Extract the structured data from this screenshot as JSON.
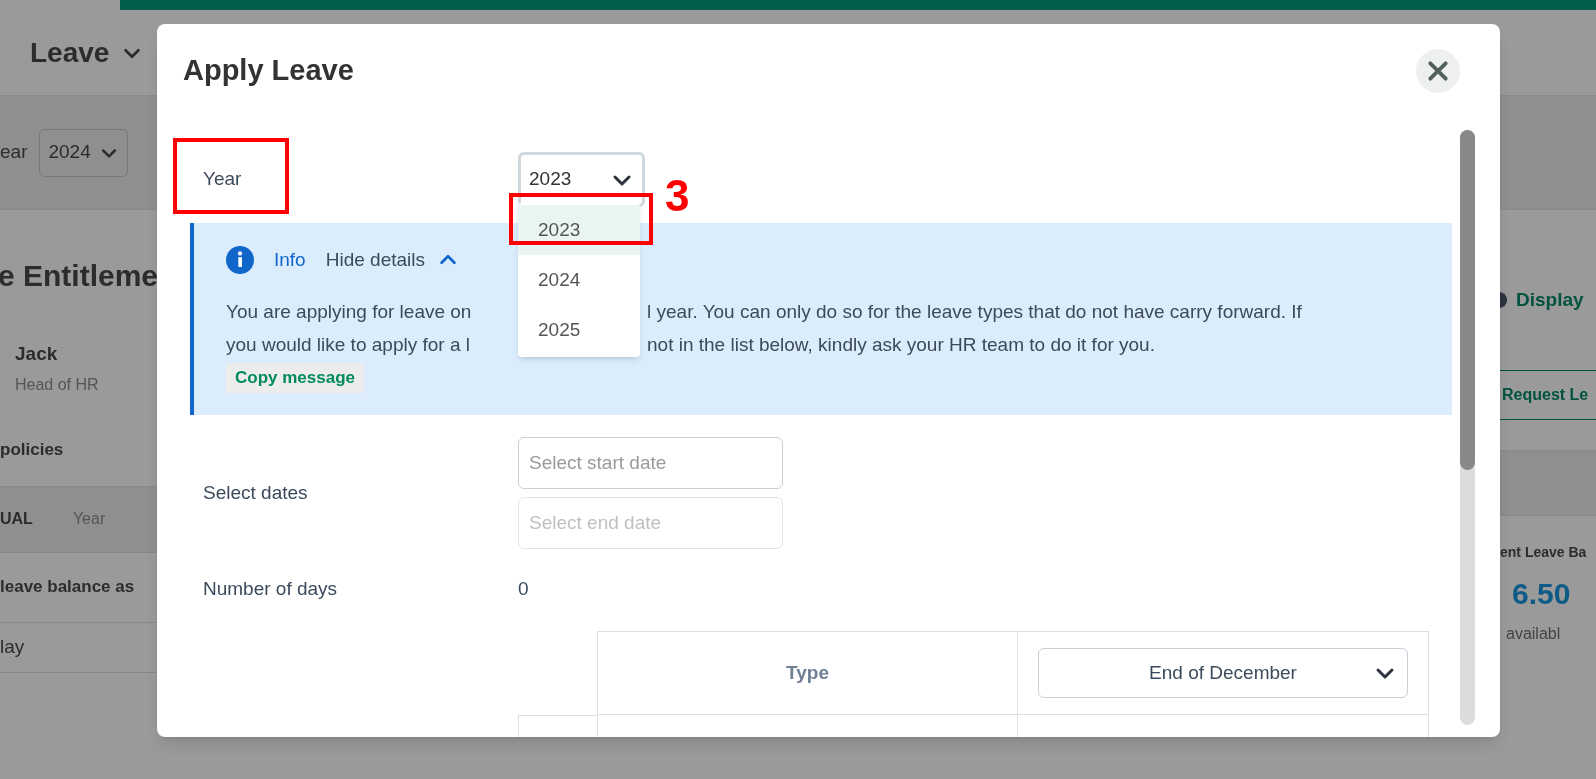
{
  "background": {
    "page_title": "Leave",
    "year_label": "ear",
    "year_value": "2024",
    "section_title": "e Entitleme",
    "employee_name": "Jack",
    "employee_role": "Head of HR",
    "policies_label": "policies",
    "tabs": [
      "UAL",
      "Year"
    ],
    "balance_caption": "leave balance as",
    "row_text": "lay",
    "display_link": "Display",
    "request_button": "Request Le",
    "balance_title": "ent Leave Ba",
    "balance_value": "6.50",
    "balance_unit": "availabl"
  },
  "dialog": {
    "title": "Apply Leave",
    "year": {
      "label": "Year",
      "value": "2023",
      "options": [
        {
          "label": "2023",
          "selected": true
        },
        {
          "label": "2024",
          "selected": false
        },
        {
          "label": "2025",
          "selected": false
        }
      ]
    },
    "info": {
      "heading": "Info",
      "toggle": "Hide details",
      "lines": [
        [
          "You are applying for leave on",
          "l year. You can only do so for the leave types that do not have carry forward. If"
        ],
        [
          "you would like to apply for a l",
          "not in the list below, kindly ask your HR team to do it for you."
        ]
      ],
      "copy_button": "Copy message"
    },
    "dates": {
      "label": "Select dates",
      "start_placeholder": "Select start date",
      "end_placeholder": "Select end date"
    },
    "days": {
      "label": "Number of days",
      "value": "0"
    },
    "table": {
      "column_header": "Type",
      "period_select": "End of December"
    }
  },
  "annotations": {
    "step_label": "3",
    "boxes": [
      {
        "kind": "box"
      },
      {
        "kind": "box"
      }
    ]
  }
}
